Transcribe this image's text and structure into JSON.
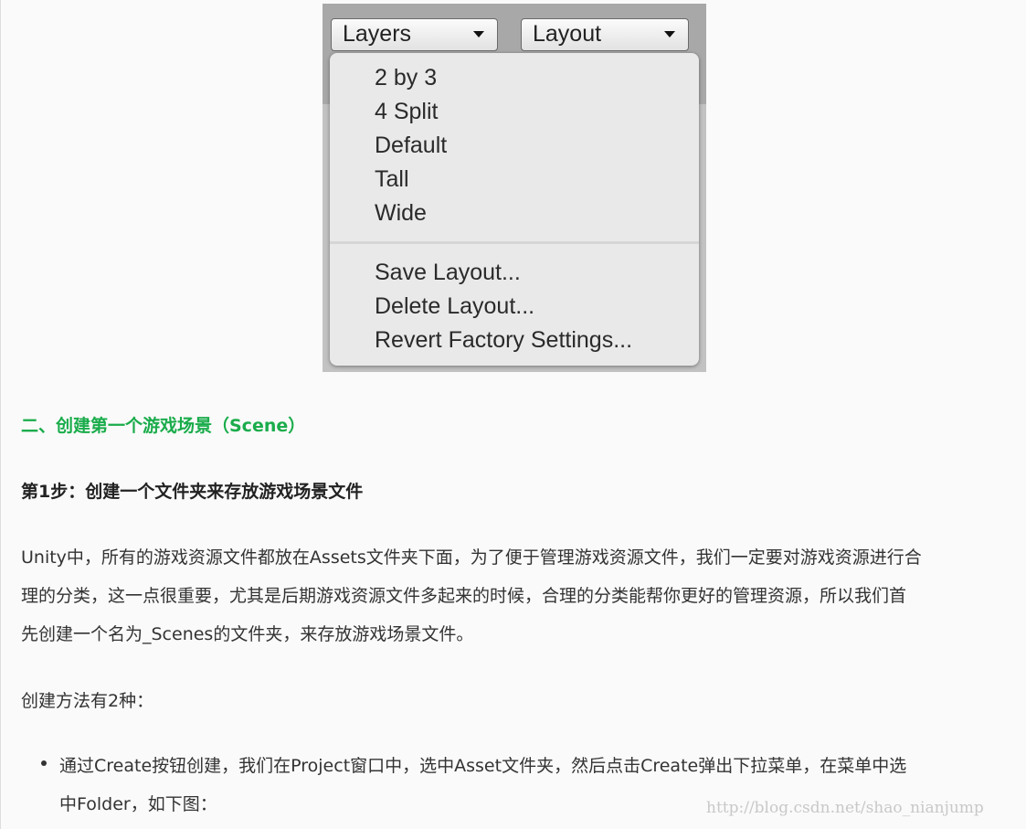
{
  "screenshot": {
    "layers_button": "Layers",
    "layout_button": "Layout",
    "menu_items": [
      "2 by 3",
      "4 Split",
      "Default",
      "Tall",
      "Wide"
    ],
    "menu_actions": [
      "Save Layout...",
      "Delete Layout...",
      "Revert Factory Settings..."
    ]
  },
  "article": {
    "section_title": "二、创建第一个游戏场景（Scene）",
    "step_title": "第1步：创建一个文件夹来存放游戏场景文件",
    "paragraph_lines": [
      "Unity中，所有的游戏资源文件都放在Assets文件夹下面，为了便于管理游戏资源文件，我们一定要对游戏资源进行合",
      "理的分类，这一点很重要，尤其是后期游戏资源文件多起来的时候，合理的分类能帮你更好的管理资源，所以我们首",
      "先创建一个名为_Scenes的文件夹，来存放游戏场景文件。"
    ],
    "methods_intro": "创建方法有2种：",
    "bullet_lines": [
      "通过Create按钮创建，我们在Project窗口中，选中Asset文件夹，然后点击Create弹出下拉菜单，在菜单中选",
      "中Folder，如下图："
    ]
  },
  "watermark": "http://blog.csdn.net/shao_nianjump",
  "colors": {
    "heading": "#1aac4b",
    "text": "#333333",
    "background": "#fafafa"
  }
}
